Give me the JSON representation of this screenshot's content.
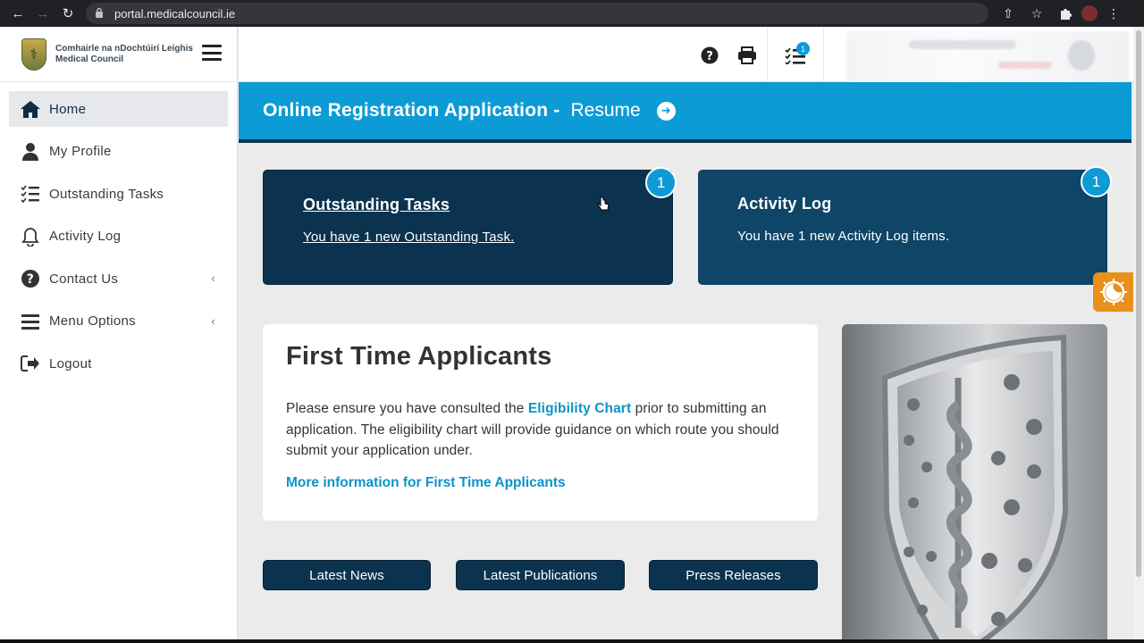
{
  "browser": {
    "url": "portal.medicalcouncil.ie"
  },
  "brand": {
    "line1": "Comhairle na nDochtúirí Leighis",
    "line2": "Medical Council"
  },
  "sidebar": {
    "items": [
      {
        "label": "Home",
        "icon": "home-icon",
        "active": true
      },
      {
        "label": "My Profile",
        "icon": "user-icon"
      },
      {
        "label": "Outstanding Tasks",
        "icon": "task-list-icon"
      },
      {
        "label": "Activity Log",
        "icon": "bell-icon"
      },
      {
        "label": "Contact Us",
        "icon": "question-circle-icon",
        "expandable": true
      },
      {
        "label": "Menu Options",
        "icon": "bars-icon",
        "expandable": true
      },
      {
        "label": "Logout",
        "icon": "logout-icon"
      }
    ]
  },
  "topbar": {
    "task_badge": "1"
  },
  "banner": {
    "title": "Online Registration Application -",
    "link": "Resume"
  },
  "cards": {
    "tasks": {
      "title": "Outstanding Tasks",
      "text": "You have 1 new Outstanding Task.",
      "badge": "1"
    },
    "log": {
      "title": "Activity Log",
      "text": "You have 1 new Activity Log items.",
      "badge": "1"
    }
  },
  "first_time": {
    "heading": "First Time Applicants",
    "text_before": "Please ensure you have consulted the ",
    "link": "Eligibility Chart",
    "text_after": " prior to submitting an application. The eligibility chart will provide guidance on which route you should submit your application under.",
    "more": "More information for First Time Applicants"
  },
  "buttons": {
    "news": "Latest News",
    "publications": "Latest Publications",
    "press": "Press Releases"
  },
  "colors": {
    "brand_blue": "#0d9bd6",
    "navy": "#0b3350",
    "toggle_orange": "#e8901a"
  }
}
